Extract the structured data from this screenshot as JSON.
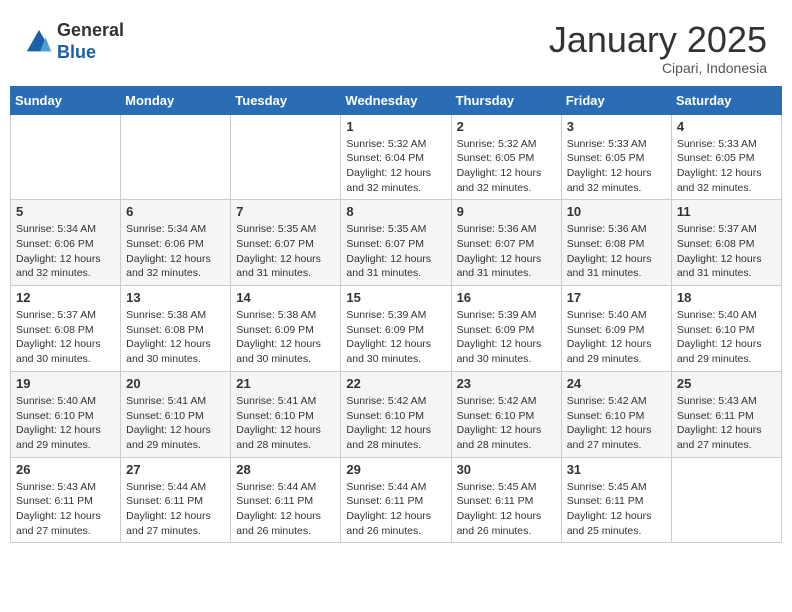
{
  "header": {
    "logo_general": "General",
    "logo_blue": "Blue",
    "month_title": "January 2025",
    "location": "Cipari, Indonesia"
  },
  "calendar": {
    "days_of_week": [
      "Sunday",
      "Monday",
      "Tuesday",
      "Wednesday",
      "Thursday",
      "Friday",
      "Saturday"
    ],
    "weeks": [
      [
        {
          "day": "",
          "info": ""
        },
        {
          "day": "",
          "info": ""
        },
        {
          "day": "",
          "info": ""
        },
        {
          "day": "1",
          "info": "Sunrise: 5:32 AM\nSunset: 6:04 PM\nDaylight: 12 hours\nand 32 minutes."
        },
        {
          "day": "2",
          "info": "Sunrise: 5:32 AM\nSunset: 6:05 PM\nDaylight: 12 hours\nand 32 minutes."
        },
        {
          "day": "3",
          "info": "Sunrise: 5:33 AM\nSunset: 6:05 PM\nDaylight: 12 hours\nand 32 minutes."
        },
        {
          "day": "4",
          "info": "Sunrise: 5:33 AM\nSunset: 6:05 PM\nDaylight: 12 hours\nand 32 minutes."
        }
      ],
      [
        {
          "day": "5",
          "info": "Sunrise: 5:34 AM\nSunset: 6:06 PM\nDaylight: 12 hours\nand 32 minutes."
        },
        {
          "day": "6",
          "info": "Sunrise: 5:34 AM\nSunset: 6:06 PM\nDaylight: 12 hours\nand 32 minutes."
        },
        {
          "day": "7",
          "info": "Sunrise: 5:35 AM\nSunset: 6:07 PM\nDaylight: 12 hours\nand 31 minutes."
        },
        {
          "day": "8",
          "info": "Sunrise: 5:35 AM\nSunset: 6:07 PM\nDaylight: 12 hours\nand 31 minutes."
        },
        {
          "day": "9",
          "info": "Sunrise: 5:36 AM\nSunset: 6:07 PM\nDaylight: 12 hours\nand 31 minutes."
        },
        {
          "day": "10",
          "info": "Sunrise: 5:36 AM\nSunset: 6:08 PM\nDaylight: 12 hours\nand 31 minutes."
        },
        {
          "day": "11",
          "info": "Sunrise: 5:37 AM\nSunset: 6:08 PM\nDaylight: 12 hours\nand 31 minutes."
        }
      ],
      [
        {
          "day": "12",
          "info": "Sunrise: 5:37 AM\nSunset: 6:08 PM\nDaylight: 12 hours\nand 30 minutes."
        },
        {
          "day": "13",
          "info": "Sunrise: 5:38 AM\nSunset: 6:08 PM\nDaylight: 12 hours\nand 30 minutes."
        },
        {
          "day": "14",
          "info": "Sunrise: 5:38 AM\nSunset: 6:09 PM\nDaylight: 12 hours\nand 30 minutes."
        },
        {
          "day": "15",
          "info": "Sunrise: 5:39 AM\nSunset: 6:09 PM\nDaylight: 12 hours\nand 30 minutes."
        },
        {
          "day": "16",
          "info": "Sunrise: 5:39 AM\nSunset: 6:09 PM\nDaylight: 12 hours\nand 30 minutes."
        },
        {
          "day": "17",
          "info": "Sunrise: 5:40 AM\nSunset: 6:09 PM\nDaylight: 12 hours\nand 29 minutes."
        },
        {
          "day": "18",
          "info": "Sunrise: 5:40 AM\nSunset: 6:10 PM\nDaylight: 12 hours\nand 29 minutes."
        }
      ],
      [
        {
          "day": "19",
          "info": "Sunrise: 5:40 AM\nSunset: 6:10 PM\nDaylight: 12 hours\nand 29 minutes."
        },
        {
          "day": "20",
          "info": "Sunrise: 5:41 AM\nSunset: 6:10 PM\nDaylight: 12 hours\nand 29 minutes."
        },
        {
          "day": "21",
          "info": "Sunrise: 5:41 AM\nSunset: 6:10 PM\nDaylight: 12 hours\nand 28 minutes."
        },
        {
          "day": "22",
          "info": "Sunrise: 5:42 AM\nSunset: 6:10 PM\nDaylight: 12 hours\nand 28 minutes."
        },
        {
          "day": "23",
          "info": "Sunrise: 5:42 AM\nSunset: 6:10 PM\nDaylight: 12 hours\nand 28 minutes."
        },
        {
          "day": "24",
          "info": "Sunrise: 5:42 AM\nSunset: 6:10 PM\nDaylight: 12 hours\nand 27 minutes."
        },
        {
          "day": "25",
          "info": "Sunrise: 5:43 AM\nSunset: 6:11 PM\nDaylight: 12 hours\nand 27 minutes."
        }
      ],
      [
        {
          "day": "26",
          "info": "Sunrise: 5:43 AM\nSunset: 6:11 PM\nDaylight: 12 hours\nand 27 minutes."
        },
        {
          "day": "27",
          "info": "Sunrise: 5:44 AM\nSunset: 6:11 PM\nDaylight: 12 hours\nand 27 minutes."
        },
        {
          "day": "28",
          "info": "Sunrise: 5:44 AM\nSunset: 6:11 PM\nDaylight: 12 hours\nand 26 minutes."
        },
        {
          "day": "29",
          "info": "Sunrise: 5:44 AM\nSunset: 6:11 PM\nDaylight: 12 hours\nand 26 minutes."
        },
        {
          "day": "30",
          "info": "Sunrise: 5:45 AM\nSunset: 6:11 PM\nDaylight: 12 hours\nand 26 minutes."
        },
        {
          "day": "31",
          "info": "Sunrise: 5:45 AM\nSunset: 6:11 PM\nDaylight: 12 hours\nand 25 minutes."
        },
        {
          "day": "",
          "info": ""
        }
      ]
    ]
  }
}
